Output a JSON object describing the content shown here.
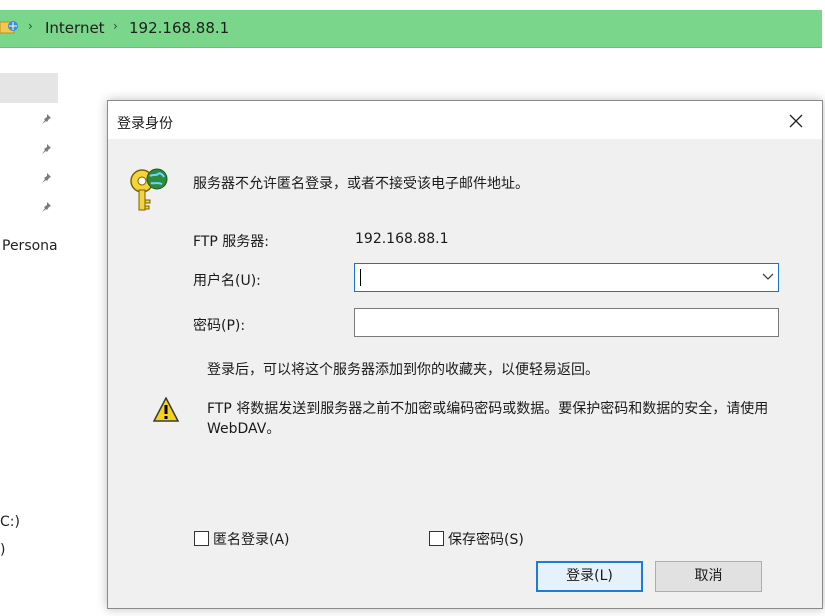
{
  "explorer": {
    "breadcrumb": [
      "Internet",
      "192.168.88.1"
    ],
    "nav_labels": {
      "personal": "Persona",
      "drive_c": "C:)",
      "paren": ")"
    }
  },
  "dialog": {
    "title": "登录身份",
    "message": "服务器不允许匿名登录，或者不接受该电子邮件地址。",
    "server_label": "FTP 服务器:",
    "server_value": "192.168.88.1",
    "username_label": "用户名(U):",
    "username_value": "",
    "password_label": "密码(P):",
    "password_value": "",
    "favorites_note": "登录后，可以将这个服务器添加到你的收藏夹，以便轻易返回。",
    "warning_line1": "FTP 将数据发送到服务器之前不加密或编码密码或数据。要保护密码和数据的安全，请使用",
    "warning_line2": "WebDAV。",
    "anonymous_label": "匿名登录(A)",
    "save_password_label": "保存密码(S)",
    "login_button": "登录(L)",
    "cancel_button": "取消"
  },
  "colors": {
    "address_bar": "#79d68a",
    "dialog_body": "#f0f0f0",
    "focus_border": "#1a73c8"
  }
}
